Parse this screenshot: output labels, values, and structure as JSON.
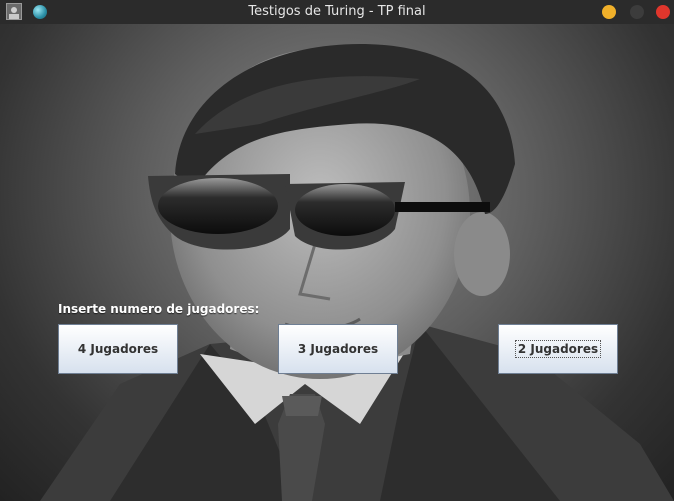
{
  "window": {
    "title": "Testigos de Turing - TP final"
  },
  "prompt": "Inserte numero de jugadores:",
  "buttons": [
    {
      "label": "4 Jugadores"
    },
    {
      "label": "3 Jugadores"
    },
    {
      "label": "2 Jugadores",
      "focused": true
    }
  ],
  "colors": {
    "titlebar": "#2b2b2b",
    "button_top": "#ffffff",
    "button_bottom": "#d7e1ee",
    "minimize": "#f0b02a",
    "close": "#e0362c"
  },
  "icons": [
    "app-icon",
    "sphere-icon",
    "minimize-icon",
    "maximize-icon",
    "close-icon"
  ]
}
